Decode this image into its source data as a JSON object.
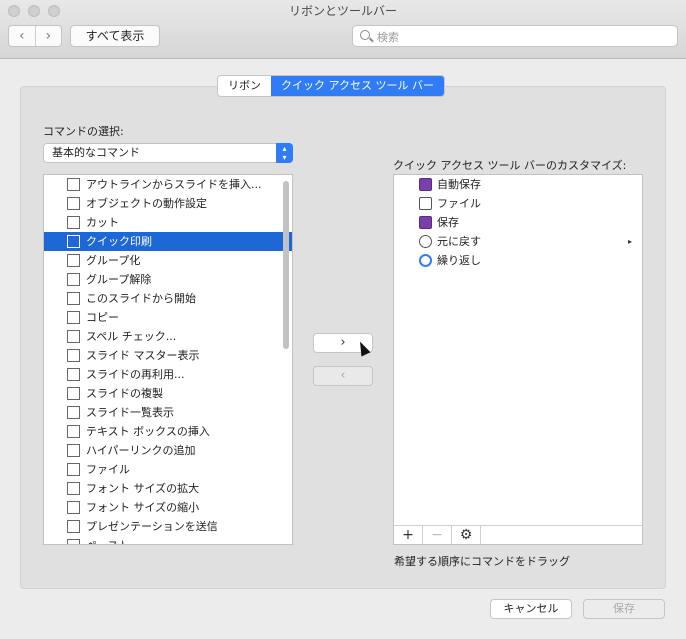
{
  "window": {
    "title": "リボンとツールバー",
    "show_all": "すべて表示",
    "back": "‹",
    "forward": "›"
  },
  "search": {
    "placeholder": "検索"
  },
  "tabs": [
    {
      "label": "リボン"
    },
    {
      "label": "クイック アクセス ツール バー"
    }
  ],
  "left": {
    "label": "コマンドの選択:",
    "selected": "基本的なコマンド",
    "items": [
      {
        "label": "アウトラインからスライドを挿入..."
      },
      {
        "label": "オブジェクトの動作設定"
      },
      {
        "label": "カット"
      },
      {
        "label": "クイック印刷"
      },
      {
        "label": "グループ化"
      },
      {
        "label": "グループ解除"
      },
      {
        "label": "このスライドから開始"
      },
      {
        "label": "コピー"
      },
      {
        "label": "スペル チェック..."
      },
      {
        "label": "スライド マスター表示"
      },
      {
        "label": "スライドの再利用..."
      },
      {
        "label": "スライドの複製"
      },
      {
        "label": "スライド一覧表示"
      },
      {
        "label": "テキスト ボックスの挿入"
      },
      {
        "label": "ハイパーリンクの追加"
      },
      {
        "label": "ファイル"
      },
      {
        "label": "フォント サイズの拡大"
      },
      {
        "label": "フォント サイズの縮小"
      },
      {
        "label": "プレゼンテーションを送信"
      },
      {
        "label": "ペースト"
      }
    ],
    "selected_index": 3
  },
  "move": {
    "add": "›",
    "remove": "‹"
  },
  "right": {
    "label": "クイック アクセス ツール バーのカスタマイズ:",
    "items": [
      {
        "label": "自動保存",
        "icon": "autosave-icon"
      },
      {
        "label": "ファイル",
        "icon": "folder-icon"
      },
      {
        "label": "保存",
        "icon": "save-icon"
      },
      {
        "label": "元に戻す",
        "icon": "undo-icon",
        "submenu": "▸"
      },
      {
        "label": "繰り返し",
        "icon": "redo-icon"
      }
    ],
    "toolbar": {
      "add": "+",
      "remove": "−",
      "settings": "⚙"
    },
    "hint": "希望する順序にコマンドをドラッグ"
  },
  "buttons": {
    "cancel": "キャンセル",
    "save": "保存"
  },
  "colors": {
    "accent": "#2f7cf6",
    "selection": "#1e67d6"
  }
}
